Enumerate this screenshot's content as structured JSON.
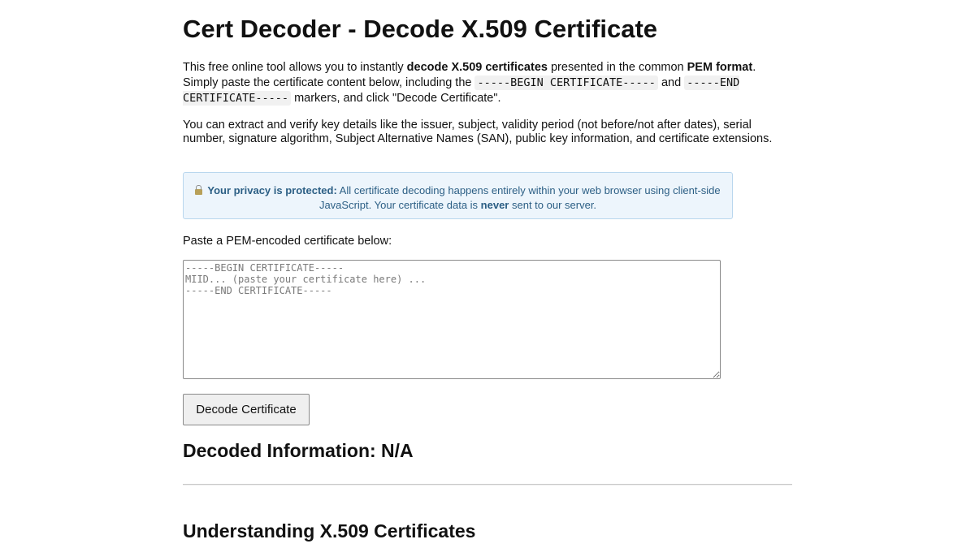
{
  "page": {
    "title": "Cert Decoder - Decode X.509 Certificate"
  },
  "intro": {
    "part1": "This free online tool allows you to instantly ",
    "bold1": "decode X.509 certificates",
    "part2": " presented in the common ",
    "bold2": "PEM format",
    "part3": ". Simply paste the certificate content below, including the ",
    "code1": "-----BEGIN CERTIFICATE-----",
    "part4": " and ",
    "code2": "-----END CERTIFICATE-----",
    "part5": " markers, and click \"Decode Certificate\"."
  },
  "extract_text": "You can extract and verify key details like the issuer, subject, validity period (not before/not after dates), serial number, signature algorithm, Subject Alternative Names (SAN), public key information, and certificate extensions.",
  "privacy": {
    "icon": "lock-icon",
    "bold": "Your privacy is protected:",
    "part1": " All certificate decoding happens entirely within your web browser using client-side JavaScript. Your certificate data is ",
    "bold2": "never",
    "part2": " sent to our server.",
    "accent_color": "#2c5f85",
    "background_color": "#edf5fc"
  },
  "input": {
    "label": "Paste a PEM-encoded certificate below:",
    "placeholder": "-----BEGIN CERTIFICATE-----\nMIID... (paste your certificate here) ...\n-----END CERTIFICATE-----",
    "value": ""
  },
  "actions": {
    "decode_label": "Decode Certificate"
  },
  "decoded": {
    "title": "Decoded Information: N/A"
  },
  "understanding": {
    "title": "Understanding X.509 Certificates"
  }
}
